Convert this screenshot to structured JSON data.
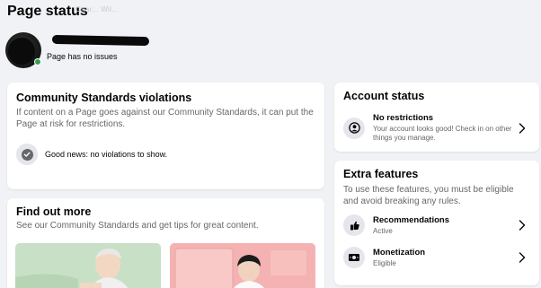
{
  "page": {
    "title": "Page status"
  },
  "profile": {
    "name_faint": "Char... Wil...",
    "status": "Page has no issues"
  },
  "community": {
    "title": "Community Standards violations",
    "description": "If content on a Page goes against our Community Standards, it can put the Page at risk for restrictions.",
    "good_news": "Good news: no violations to show."
  },
  "find_out": {
    "title": "Find out more",
    "description": "See our Community Standards and get tips for great content."
  },
  "account_status": {
    "title": "Account status",
    "row_title": "No restrictions",
    "row_sub": "Your account looks good! Check in on other things you manage."
  },
  "extra_features": {
    "title": "Extra features",
    "description": "To use these features, you must be eligible and avoid breaking any rules.",
    "items": [
      {
        "title": "Recommendations",
        "status": "Active",
        "icon": "recommendations-icon"
      },
      {
        "title": "Monetization",
        "status": "Eligible",
        "icon": "monetization-icon"
      }
    ]
  },
  "colors": {
    "background": "#f0f2f5",
    "card": "#ffffff",
    "secondary_text": "#65676b",
    "online": "#31a24c"
  }
}
